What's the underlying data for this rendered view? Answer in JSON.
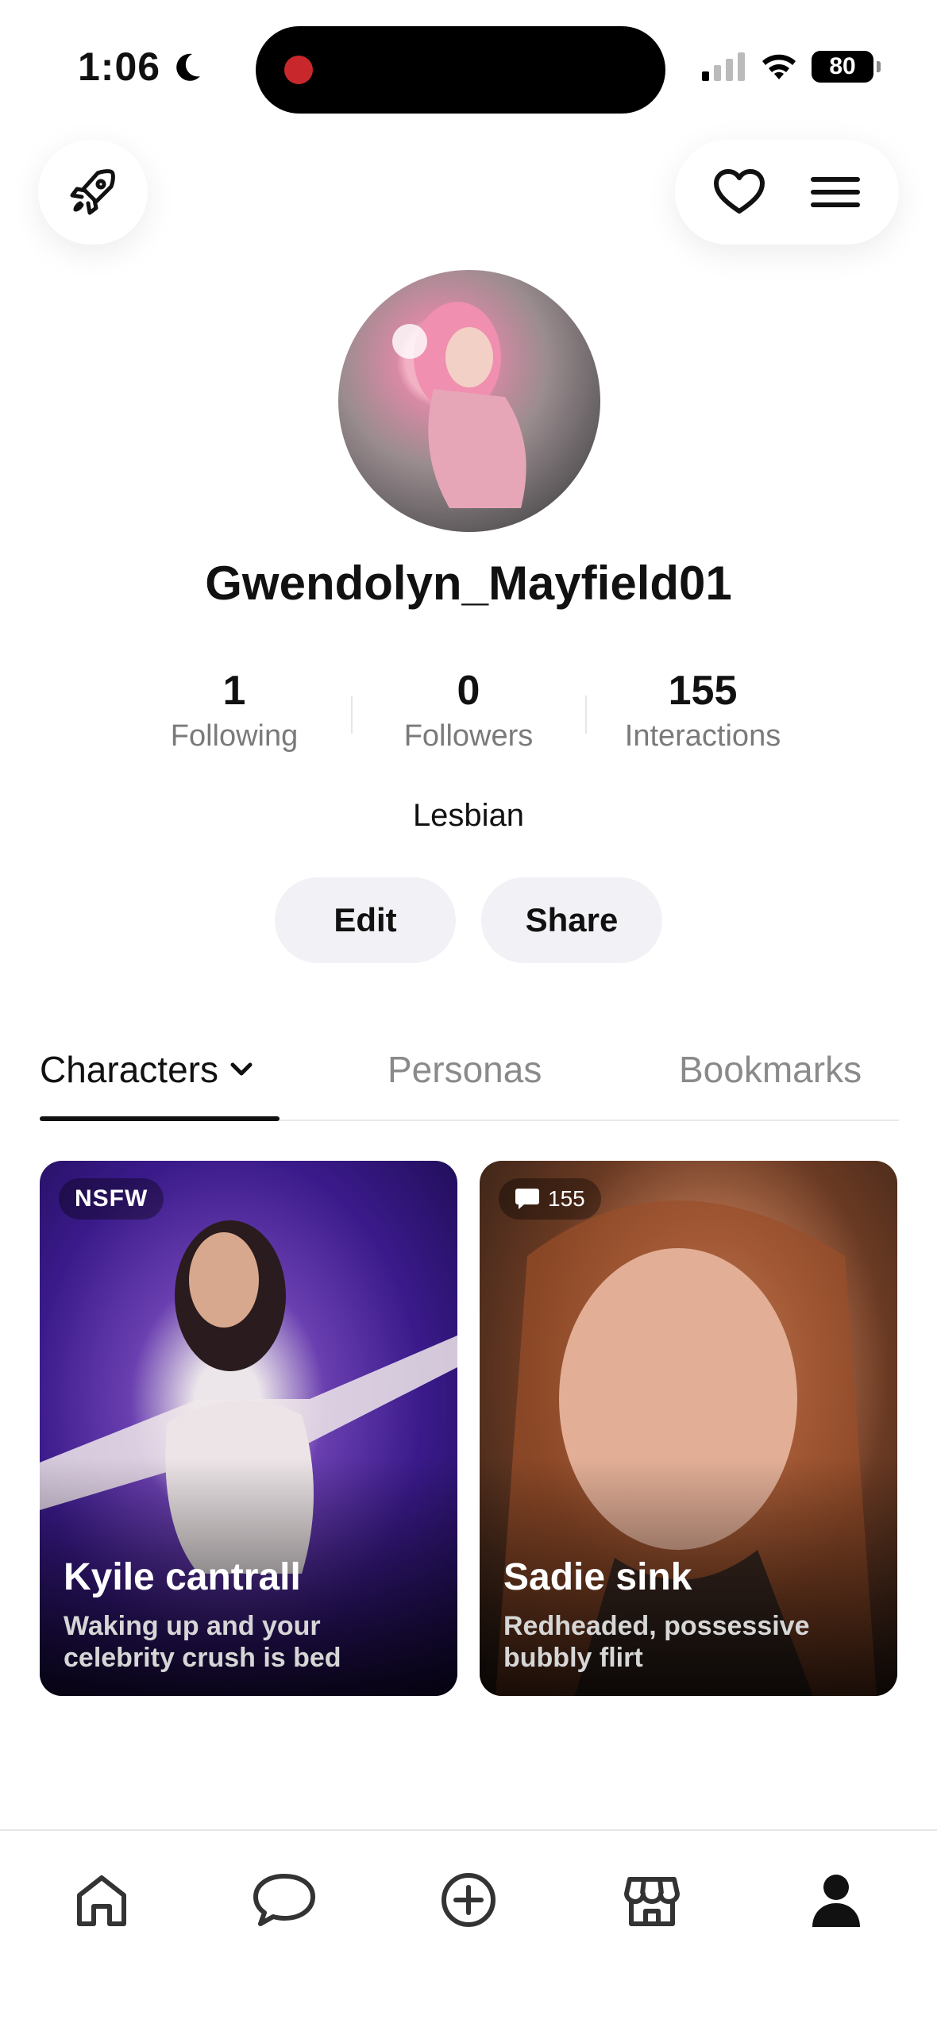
{
  "status": {
    "time": "1:06",
    "battery": "80"
  },
  "profile": {
    "username": "Gwendolyn_Mayfield01",
    "bio": "Lesbian",
    "stats": [
      {
        "value": "1",
        "label": "Following"
      },
      {
        "value": "0",
        "label": "Followers"
      },
      {
        "value": "155",
        "label": "Interactions"
      }
    ],
    "edit_label": "Edit",
    "share_label": "Share"
  },
  "tabs": [
    {
      "label": "Characters",
      "active": true
    },
    {
      "label": "Personas",
      "active": false
    },
    {
      "label": "Bookmarks",
      "active": false
    }
  ],
  "cards": [
    {
      "badge": "NSFW",
      "title": "Kyile cantrall",
      "subtitle": "Waking up and your celebrity crush is bed"
    },
    {
      "badge": "155",
      "title": "Sadie sink",
      "subtitle": "Redheaded, possessive bubbly flirt"
    }
  ],
  "nav": [
    {
      "icon": "home-icon",
      "active": false
    },
    {
      "icon": "chat-icon",
      "active": false
    },
    {
      "icon": "plus-circle-icon",
      "active": false
    },
    {
      "icon": "store-icon",
      "active": false
    },
    {
      "icon": "profile-icon",
      "active": true
    }
  ]
}
